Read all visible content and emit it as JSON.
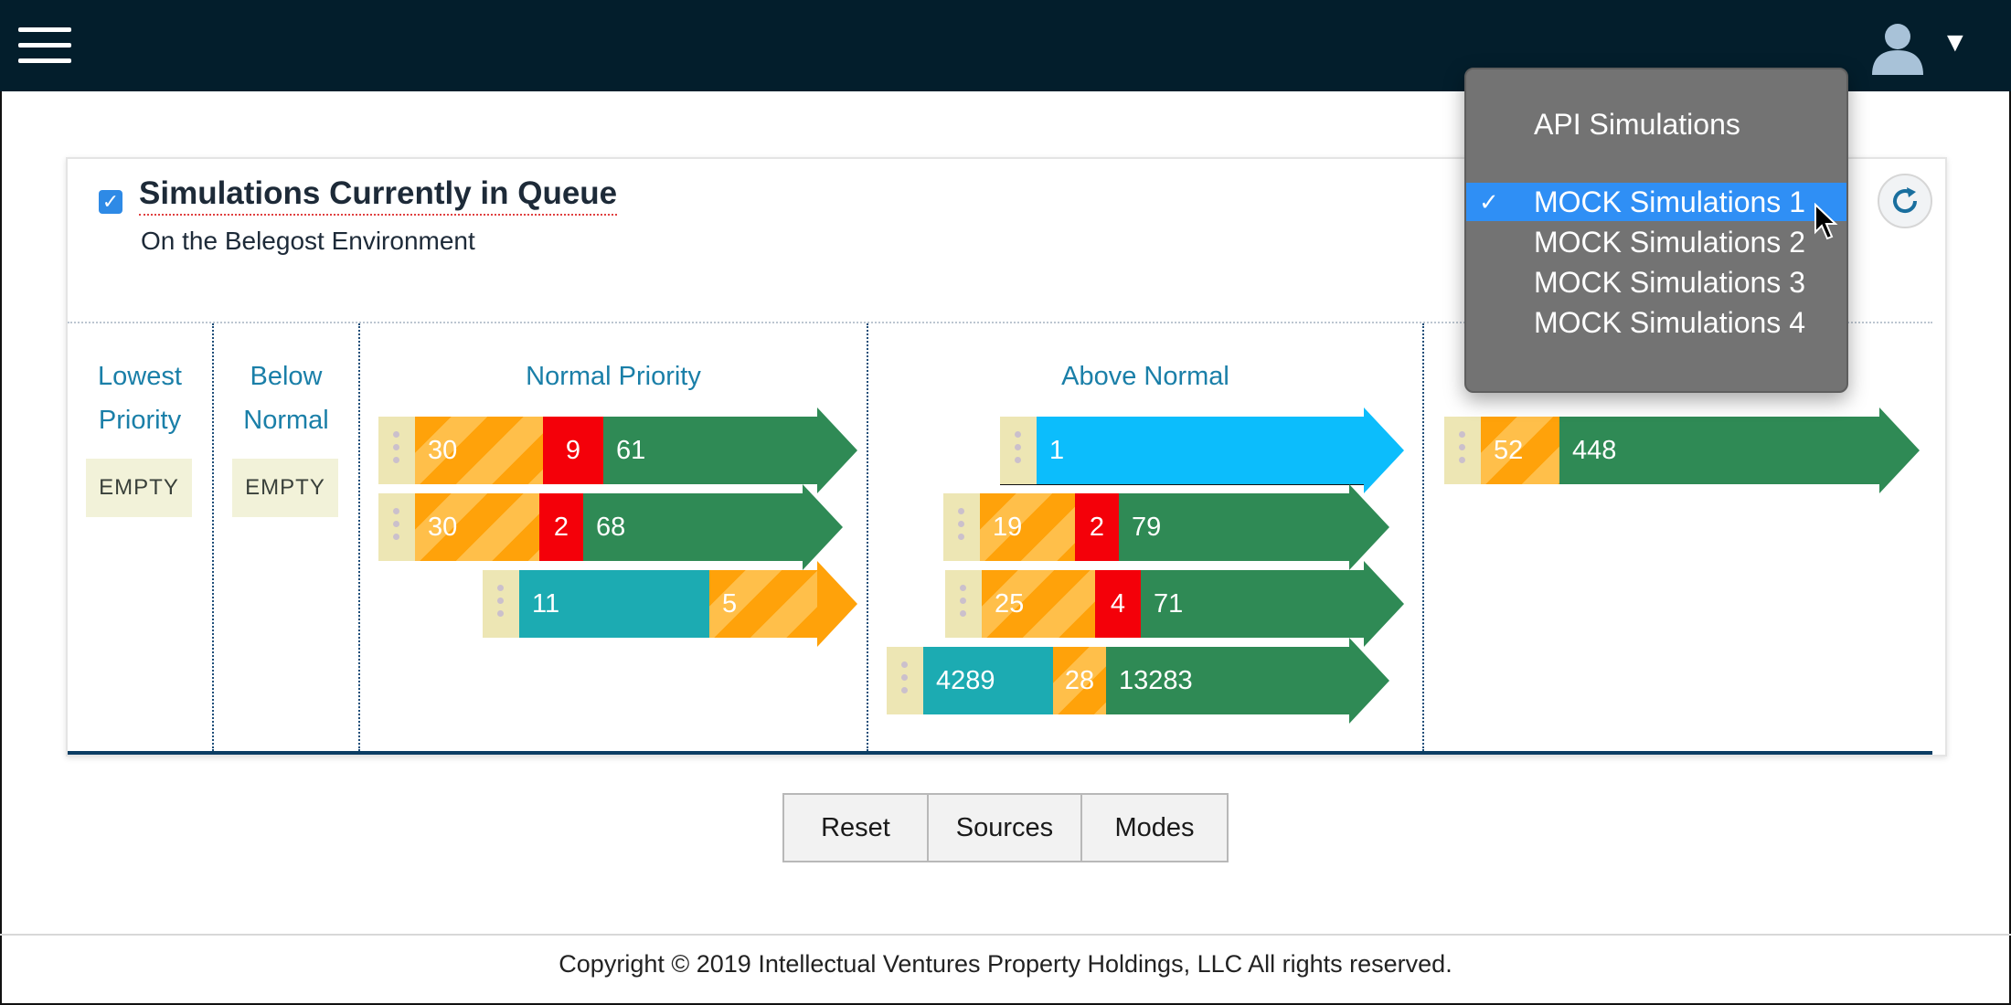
{
  "header": {
    "menu_icon": "hamburger-menu-icon",
    "user_icon": "user-icon",
    "caret": "▼"
  },
  "panel": {
    "checkbox_checked": true,
    "title": "Simulations Currently in Queue",
    "subtitle": "On the Belegost Environment",
    "refresh_icon": "refresh-icon"
  },
  "columns": {
    "lowest": {
      "title_line1": "Lowest",
      "title_line2": "Priority",
      "status": "EMPTY"
    },
    "below": {
      "title_line1": "Below",
      "title_line2": "Normal",
      "status": "EMPTY"
    },
    "normal": {
      "title": "Normal Priority"
    },
    "above": {
      "title": "Above Normal"
    }
  },
  "queues": {
    "normal_row1": [
      "30",
      "9",
      "61"
    ],
    "normal_row2": [
      "30",
      "2",
      "68"
    ],
    "normal_row3": [
      "11",
      "5"
    ],
    "above_row1": [
      "1"
    ],
    "above_row2": [
      "19",
      "2",
      "79"
    ],
    "above_row3": [
      "25",
      "4",
      "71"
    ],
    "above_row4": [
      "4289",
      "28",
      "13283"
    ],
    "high_row1": [
      "52",
      "448"
    ]
  },
  "buttons": {
    "reset": "Reset",
    "sources": "Sources",
    "modes": "Modes"
  },
  "dropdown": {
    "header": "API Simulations",
    "items": [
      "MOCK Simulations 1",
      "MOCK Simulations 2",
      "MOCK Simulations 3",
      "MOCK Simulations 4"
    ],
    "selected": "MOCK Simulations 1",
    "check": "✓"
  },
  "footer": {
    "copyright": "Copyright © 2019 Intellectual Ventures Property Holdings, LLC All rights reserved."
  },
  "colors": {
    "topbar": "#031e2c",
    "segment_orange": "#ffa20a",
    "segment_red": "#f40009",
    "segment_green": "#2f8a55",
    "segment_teal": "#1cabb2",
    "segment_blue": "#0cbdfc",
    "column_title": "#1a7fa8",
    "dropdown_selected": "#2f8ff5"
  }
}
